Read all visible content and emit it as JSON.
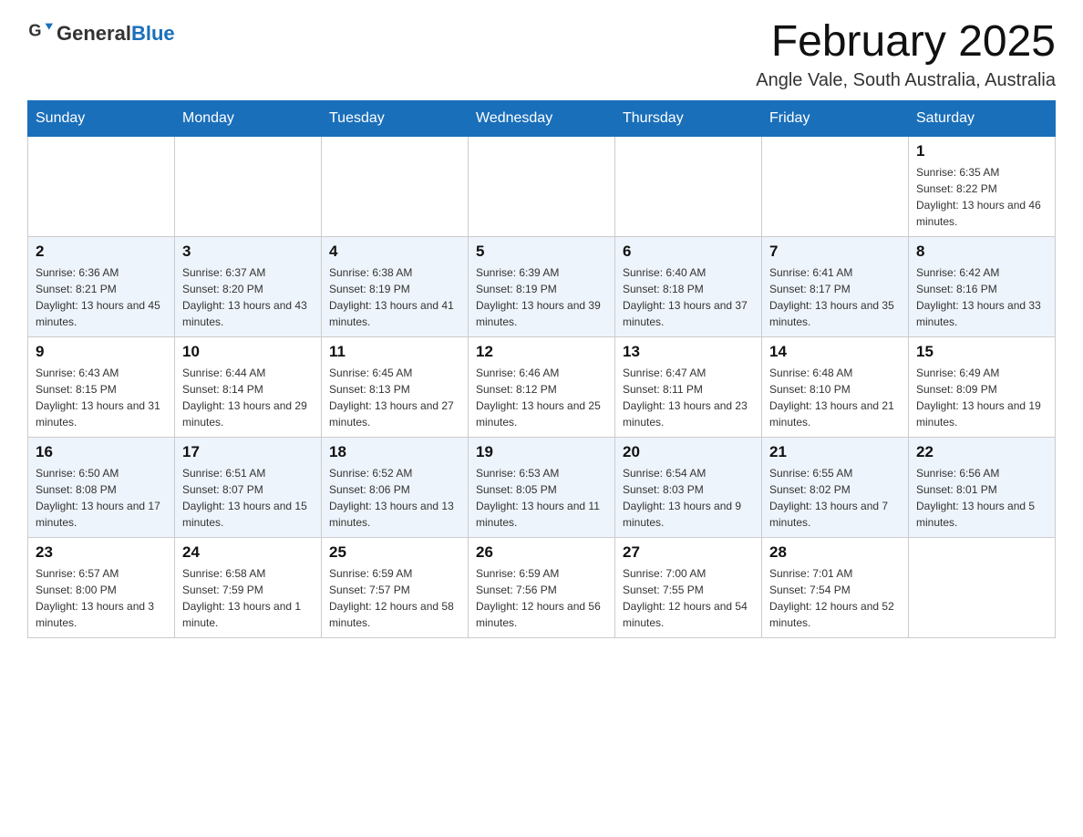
{
  "header": {
    "logo_general": "General",
    "logo_blue": "Blue",
    "title": "February 2025",
    "subtitle": "Angle Vale, South Australia, Australia"
  },
  "days_of_week": [
    "Sunday",
    "Monday",
    "Tuesday",
    "Wednesday",
    "Thursday",
    "Friday",
    "Saturday"
  ],
  "weeks": [
    {
      "days": [
        {
          "date": "",
          "info": ""
        },
        {
          "date": "",
          "info": ""
        },
        {
          "date": "",
          "info": ""
        },
        {
          "date": "",
          "info": ""
        },
        {
          "date": "",
          "info": ""
        },
        {
          "date": "",
          "info": ""
        },
        {
          "date": "1",
          "info": "Sunrise: 6:35 AM\nSunset: 8:22 PM\nDaylight: 13 hours and 46 minutes."
        }
      ]
    },
    {
      "days": [
        {
          "date": "2",
          "info": "Sunrise: 6:36 AM\nSunset: 8:21 PM\nDaylight: 13 hours and 45 minutes."
        },
        {
          "date": "3",
          "info": "Sunrise: 6:37 AM\nSunset: 8:20 PM\nDaylight: 13 hours and 43 minutes."
        },
        {
          "date": "4",
          "info": "Sunrise: 6:38 AM\nSunset: 8:19 PM\nDaylight: 13 hours and 41 minutes."
        },
        {
          "date": "5",
          "info": "Sunrise: 6:39 AM\nSunset: 8:19 PM\nDaylight: 13 hours and 39 minutes."
        },
        {
          "date": "6",
          "info": "Sunrise: 6:40 AM\nSunset: 8:18 PM\nDaylight: 13 hours and 37 minutes."
        },
        {
          "date": "7",
          "info": "Sunrise: 6:41 AM\nSunset: 8:17 PM\nDaylight: 13 hours and 35 minutes."
        },
        {
          "date": "8",
          "info": "Sunrise: 6:42 AM\nSunset: 8:16 PM\nDaylight: 13 hours and 33 minutes."
        }
      ]
    },
    {
      "days": [
        {
          "date": "9",
          "info": "Sunrise: 6:43 AM\nSunset: 8:15 PM\nDaylight: 13 hours and 31 minutes."
        },
        {
          "date": "10",
          "info": "Sunrise: 6:44 AM\nSunset: 8:14 PM\nDaylight: 13 hours and 29 minutes."
        },
        {
          "date": "11",
          "info": "Sunrise: 6:45 AM\nSunset: 8:13 PM\nDaylight: 13 hours and 27 minutes."
        },
        {
          "date": "12",
          "info": "Sunrise: 6:46 AM\nSunset: 8:12 PM\nDaylight: 13 hours and 25 minutes."
        },
        {
          "date": "13",
          "info": "Sunrise: 6:47 AM\nSunset: 8:11 PM\nDaylight: 13 hours and 23 minutes."
        },
        {
          "date": "14",
          "info": "Sunrise: 6:48 AM\nSunset: 8:10 PM\nDaylight: 13 hours and 21 minutes."
        },
        {
          "date": "15",
          "info": "Sunrise: 6:49 AM\nSunset: 8:09 PM\nDaylight: 13 hours and 19 minutes."
        }
      ]
    },
    {
      "days": [
        {
          "date": "16",
          "info": "Sunrise: 6:50 AM\nSunset: 8:08 PM\nDaylight: 13 hours and 17 minutes."
        },
        {
          "date": "17",
          "info": "Sunrise: 6:51 AM\nSunset: 8:07 PM\nDaylight: 13 hours and 15 minutes."
        },
        {
          "date": "18",
          "info": "Sunrise: 6:52 AM\nSunset: 8:06 PM\nDaylight: 13 hours and 13 minutes."
        },
        {
          "date": "19",
          "info": "Sunrise: 6:53 AM\nSunset: 8:05 PM\nDaylight: 13 hours and 11 minutes."
        },
        {
          "date": "20",
          "info": "Sunrise: 6:54 AM\nSunset: 8:03 PM\nDaylight: 13 hours and 9 minutes."
        },
        {
          "date": "21",
          "info": "Sunrise: 6:55 AM\nSunset: 8:02 PM\nDaylight: 13 hours and 7 minutes."
        },
        {
          "date": "22",
          "info": "Sunrise: 6:56 AM\nSunset: 8:01 PM\nDaylight: 13 hours and 5 minutes."
        }
      ]
    },
    {
      "days": [
        {
          "date": "23",
          "info": "Sunrise: 6:57 AM\nSunset: 8:00 PM\nDaylight: 13 hours and 3 minutes."
        },
        {
          "date": "24",
          "info": "Sunrise: 6:58 AM\nSunset: 7:59 PM\nDaylight: 13 hours and 1 minute."
        },
        {
          "date": "25",
          "info": "Sunrise: 6:59 AM\nSunset: 7:57 PM\nDaylight: 12 hours and 58 minutes."
        },
        {
          "date": "26",
          "info": "Sunrise: 6:59 AM\nSunset: 7:56 PM\nDaylight: 12 hours and 56 minutes."
        },
        {
          "date": "27",
          "info": "Sunrise: 7:00 AM\nSunset: 7:55 PM\nDaylight: 12 hours and 54 minutes."
        },
        {
          "date": "28",
          "info": "Sunrise: 7:01 AM\nSunset: 7:54 PM\nDaylight: 12 hours and 52 minutes."
        },
        {
          "date": "",
          "info": ""
        }
      ]
    }
  ]
}
